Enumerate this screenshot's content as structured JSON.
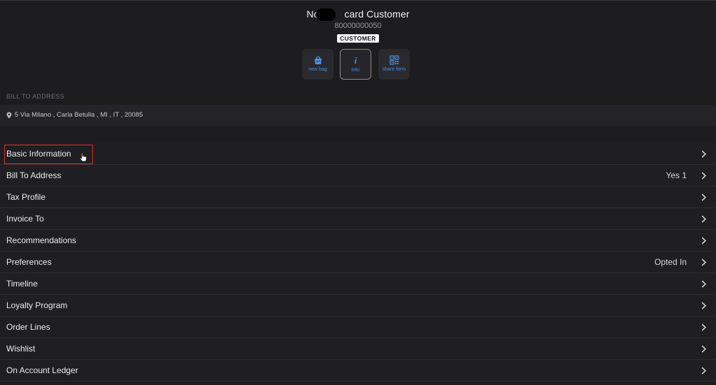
{
  "header": {
    "customer_name": "No[redacted]card Customer",
    "customer_name_visible_left": "No",
    "customer_name_visible_right": "card Customer",
    "customer_id": "80000000050",
    "badge": "CUSTOMER"
  },
  "actions": [
    {
      "label": "new bag",
      "icon": "shopping-bag-icon",
      "selected": false
    },
    {
      "label": "info",
      "icon": "info-icon",
      "selected": true
    },
    {
      "label": "share form",
      "icon": "qr-code-icon",
      "selected": false
    }
  ],
  "bill_to": {
    "section_label": "BILL TO ADDRESS",
    "address": "5 Via Milano , Carla Betulla , MI , IT , 20085",
    "icon": "location-pin-icon"
  },
  "menu": [
    {
      "label": "Basic Information",
      "value": ""
    },
    {
      "label": "Bill To Address",
      "value": "Yes 1"
    },
    {
      "label": "Tax Profile",
      "value": ""
    },
    {
      "label": "Invoice To",
      "value": ""
    },
    {
      "label": "Recommendations",
      "value": ""
    },
    {
      "label": "Preferences",
      "value": "Opted In"
    },
    {
      "label": "Timeline",
      "value": ""
    },
    {
      "label": "Loyalty Program",
      "value": ""
    },
    {
      "label": "Order Lines",
      "value": ""
    },
    {
      "label": "Wishlist",
      "value": ""
    },
    {
      "label": "On Account Ledger",
      "value": ""
    }
  ],
  "colors": {
    "background": "#1d1d20",
    "accent": "#4a90e2",
    "highlight": "#d9302c",
    "badge_bg": "#ffffff"
  }
}
